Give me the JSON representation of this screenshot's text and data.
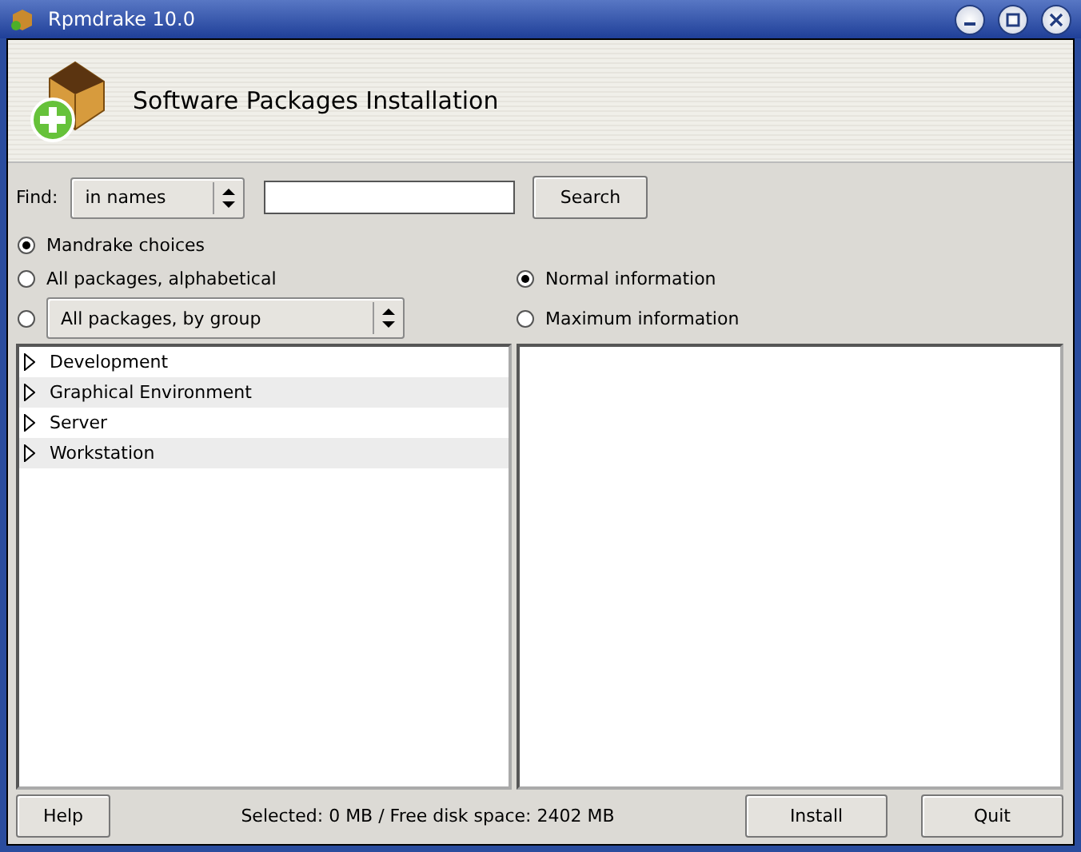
{
  "window": {
    "title": "Rpmdrake 10.0"
  },
  "header": {
    "title": "Software Packages Installation"
  },
  "find": {
    "label": "Find:",
    "mode": "in names",
    "button": "Search"
  },
  "view_options": [
    {
      "kind": "radio",
      "label": "Mandrake choices",
      "selected": true
    },
    {
      "kind": "radio",
      "label": "All packages, alphabetical",
      "selected": false
    },
    {
      "kind": "combo",
      "label": "All packages, by group",
      "selected": false
    }
  ],
  "info_options": [
    {
      "label": "Normal information",
      "selected": true
    },
    {
      "label": "Maximum information",
      "selected": false
    }
  ],
  "tree": [
    {
      "label": "Development",
      "expanded": false
    },
    {
      "label": "Graphical Environment",
      "expanded": false
    },
    {
      "label": "Server",
      "expanded": false
    },
    {
      "label": "Workstation",
      "expanded": false
    }
  ],
  "status": "Selected: 0 MB / Free disk space: 2402 MB",
  "buttons": {
    "help": "Help",
    "install": "Install",
    "quit": "Quit"
  }
}
